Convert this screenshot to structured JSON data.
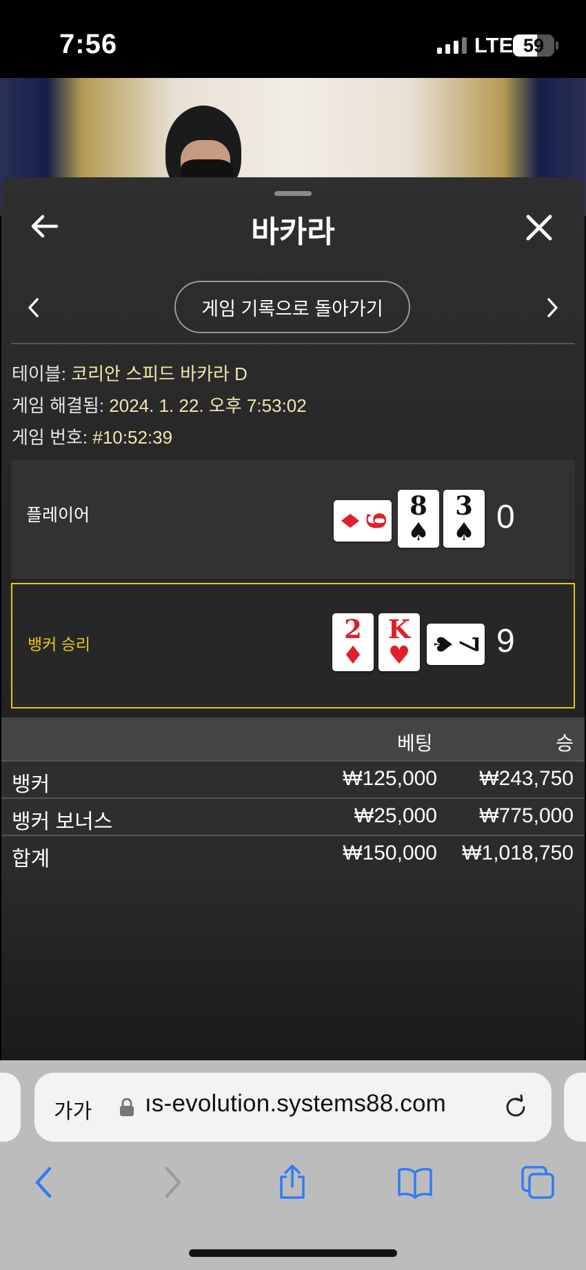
{
  "status_bar": {
    "time": "7:56",
    "network": "LTE",
    "battery": "59",
    "battery_level": 0.59
  },
  "header": {
    "title": "바카라"
  },
  "history_button": {
    "label": "게임 기록으로 돌아가기"
  },
  "info": {
    "table_label": "테이블:",
    "table_value": "코리안 스피드 바카라 D",
    "resolved_label": "게임 해결됨:",
    "resolved_value": "2024. 1. 22. 오후 7:53:02",
    "game_no_label": "게임 번호:",
    "game_no_value": "#10:52:39"
  },
  "player": {
    "label": "플레이어",
    "score": "0",
    "cards": [
      {
        "rank": "9",
        "suit": "♦",
        "color": "#e0202a",
        "sideways": true
      },
      {
        "rank": "8",
        "suit": "♠",
        "color": "#111111",
        "sideways": false
      },
      {
        "rank": "3",
        "suit": "♠",
        "color": "#111111",
        "sideways": false
      }
    ]
  },
  "banker": {
    "label": "뱅커 승리",
    "label_color": "#e6c915",
    "score": "9",
    "cards": [
      {
        "rank": "2",
        "suit": "♦",
        "color": "#e0202a",
        "sideways": false
      },
      {
        "rank": "K",
        "suit": "♥",
        "color": "#e0202a",
        "sideways": false
      },
      {
        "rank": "7",
        "suit": "♠",
        "color": "#111111",
        "sideways": true
      }
    ]
  },
  "bets": {
    "col_bet": "베팅",
    "col_win": "승",
    "rows": [
      {
        "name": "뱅커",
        "bet": "₩125,000",
        "win": "₩243,750"
      },
      {
        "name": "뱅커 보너스",
        "bet": "₩25,000",
        "win": "₩775,000"
      },
      {
        "name": "합계",
        "bet": "₩150,000",
        "win": "₩1,018,750"
      }
    ]
  },
  "browser": {
    "text_size": "가가",
    "url": "ıs-evolution.systems88.com"
  },
  "colors": {
    "accent": "#e6c915",
    "panel": "#2a2a2a",
    "toolbar_blue": "#2f7cf6"
  }
}
